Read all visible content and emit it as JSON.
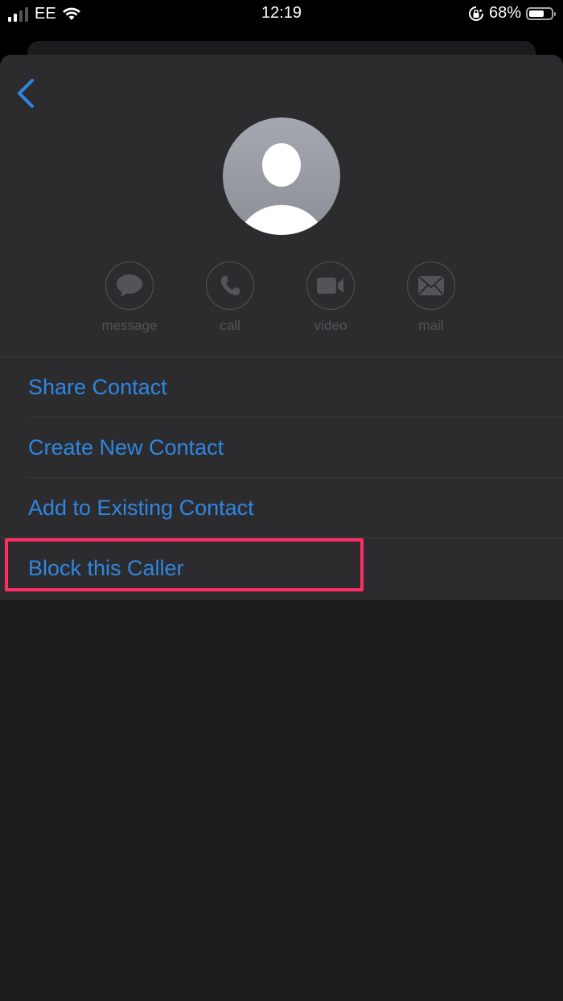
{
  "status_bar": {
    "carrier": "EE",
    "time": "12:19",
    "battery_percent": "68%",
    "battery_level": 0.68,
    "icons": [
      "signal-icon",
      "wifi-icon",
      "rotation-lock-icon",
      "battery-icon"
    ]
  },
  "nav": {
    "back_icon": "chevron-left-icon"
  },
  "contact": {
    "avatar_icon": "person-silhouette-icon"
  },
  "actions": [
    {
      "label": "message",
      "icon": "message-bubble-icon",
      "enabled": false
    },
    {
      "label": "call",
      "icon": "phone-icon",
      "enabled": false
    },
    {
      "label": "video",
      "icon": "video-camera-icon",
      "enabled": false
    },
    {
      "label": "mail",
      "icon": "envelope-icon",
      "enabled": false
    }
  ],
  "menu": [
    {
      "label": "Share Contact"
    },
    {
      "label": "Create New Contact"
    },
    {
      "label": "Add to Existing Contact"
    },
    {
      "label": "Block this Caller",
      "highlighted": true
    }
  ],
  "colors": {
    "accent": "#2f86e3",
    "highlight": "#ff2d63",
    "sheet": "#2c2c2e",
    "background": "#1c1c1e",
    "disabled": "#545458"
  }
}
